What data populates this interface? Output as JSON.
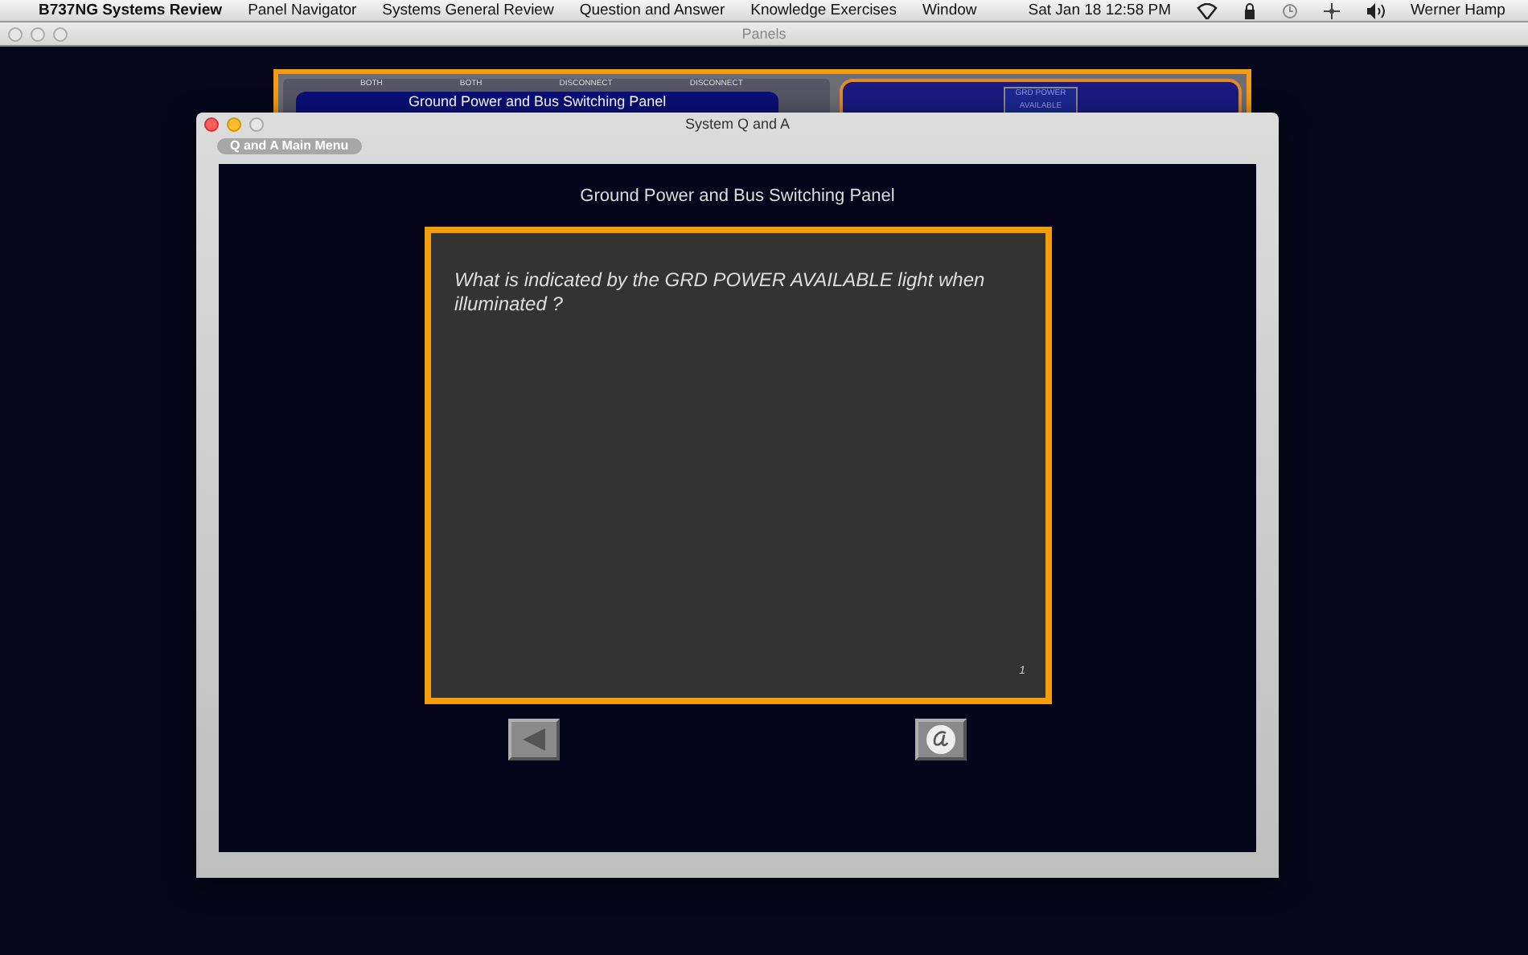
{
  "menu_bar": {
    "app_name": "B737NG Systems Review",
    "items": [
      "Panel Navigator",
      "Systems General Review",
      "Question and Answer",
      "Knowledge Exercises",
      "Window"
    ],
    "clock": "Sat Jan 18  12:58 PM",
    "user": "Werner Hamp"
  },
  "back_window": {
    "title": "Panels",
    "panel": {
      "labels": [
        "BOTH",
        "BOTH",
        "DISCONNECT",
        "DISCONNECT"
      ],
      "title": "Ground Power and Bus Switching Panel",
      "light": "GRD POWER AVAILABLE"
    }
  },
  "window": {
    "title": "System Q and A",
    "toolbar_button": "Q and A Main Menu",
    "heading": "Ground Power and Bus Switching Panel",
    "question": "What is indicated by the GRD POWER AVAILABLE light when illuminated  ?",
    "page": "1",
    "buttons": [
      {
        "kind": "back"
      },
      {
        "kind": "answer"
      }
    ]
  }
}
